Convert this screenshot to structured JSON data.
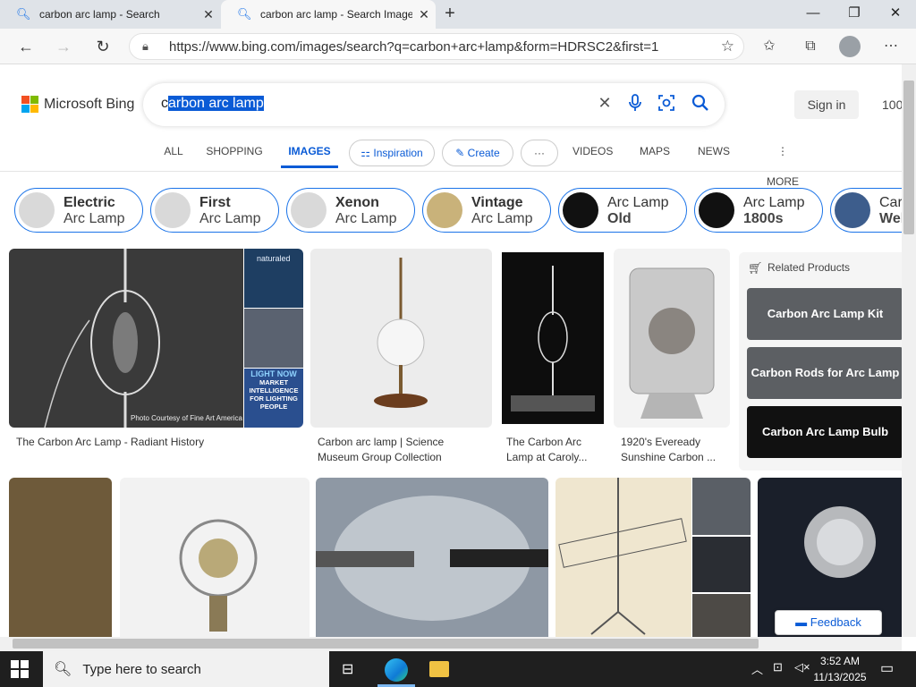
{
  "browser": {
    "tabs": [
      {
        "title": "carbon arc lamp - Search",
        "active": false
      },
      {
        "title": "carbon arc lamp - Search Images",
        "active": true
      }
    ],
    "url": "https://www.bing.com/images/search?q=carbon+arc+lamp&form=HDRSC2&first=1"
  },
  "bing": {
    "logo_text": "Microsoft Bing",
    "query_prefix": "c",
    "query_selected": "arbon arc lamp",
    "sign_in": "Sign in",
    "points": "100",
    "scopes": {
      "all": "ALL",
      "shopping": "SHOPPING",
      "images": "IMAGES",
      "inspiration": "Inspiration",
      "create": "Create",
      "more_dots": "···",
      "videos": "VIDEOS",
      "maps": "MAPS",
      "news": "NEWS",
      "more": "MORE"
    }
  },
  "chips": [
    {
      "line1": "Electric",
      "line2": "Arc Lamp"
    },
    {
      "line1": "First",
      "line2": "Arc Lamp"
    },
    {
      "line1": "Xenon",
      "line2": "Arc Lamp"
    },
    {
      "line1": "Vintage",
      "line2": "Arc Lamp"
    },
    {
      "line1": "Arc Lamp",
      "line2": "Old"
    },
    {
      "line1": "Arc Lamp",
      "line2": "1800s"
    },
    {
      "line1": "Car",
      "line2": "Wel"
    }
  ],
  "results": [
    {
      "caption": "The Carbon Arc Lamp - Radiant History",
      "overlay": "Photo Courtesy of Fine Art America"
    },
    {
      "caption_l1": "Carbon arc lamp | Science",
      "caption_l2": "Museum Group Collection"
    },
    {
      "caption_l1": "The Carbon Arc",
      "caption_l2": "Lamp at Caroly..."
    },
    {
      "caption_l1": "1920's Eveready",
      "caption_l2": "Sunshine Carbon ..."
    }
  ],
  "ad_thumbs": {
    "brand": "naturaled",
    "l1": "LIGHT NOW",
    "l2": "MARKET",
    "l3": "INTELLIGENCE",
    "l4": "FOR LIGHTING",
    "l5": "PEOPLE"
  },
  "related_products": {
    "title": "Related Products",
    "items": [
      "Carbon Arc Lamp Kit",
      "Carbon Rods for Arc Lamp",
      "Carbon Arc Lamp Bulb"
    ]
  },
  "feedback": "Feedback",
  "taskbar": {
    "search_placeholder": "Type here to search",
    "time": "3:52 AM",
    "date": "11/13/2025"
  },
  "colors": {
    "accent": "#0a5bd6",
    "ms_red": "#f25022",
    "ms_green": "#7fba00",
    "ms_blue": "#00a4ef",
    "ms_yellow": "#ffb900"
  }
}
